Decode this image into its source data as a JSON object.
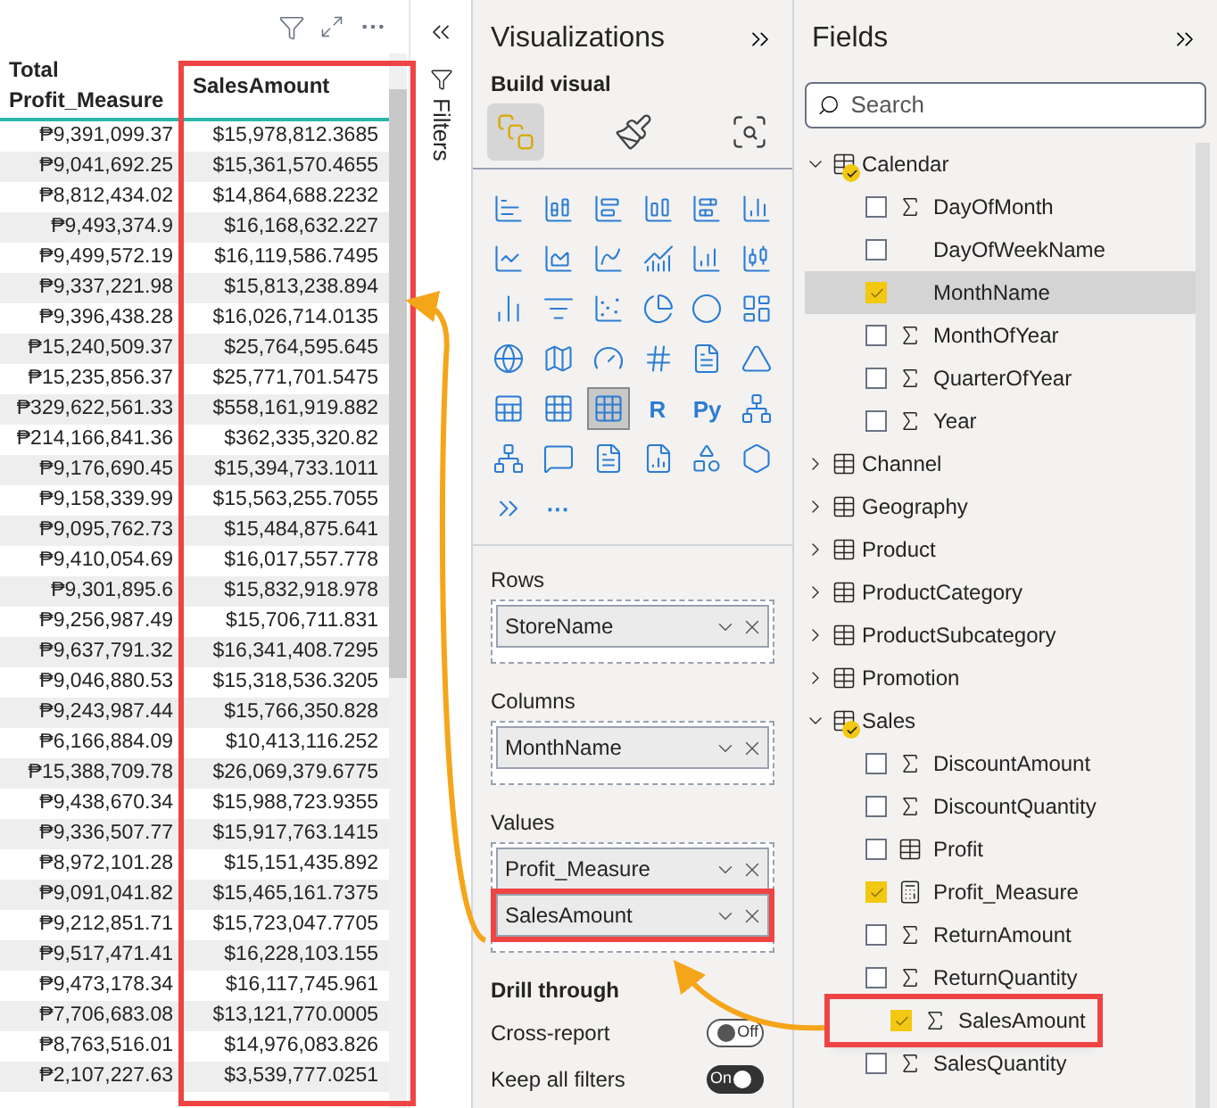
{
  "table": {
    "columns": [
      "Total Profit_Measure",
      "SalesAmount"
    ],
    "rows": [
      [
        "₱9,391,099.37",
        "$15,978,812.3685"
      ],
      [
        "₱9,041,692.25",
        "$15,361,570.4655"
      ],
      [
        "₱8,812,434.02",
        "$14,864,688.2232"
      ],
      [
        "₱9,493,374.9",
        "$16,168,632.227"
      ],
      [
        "₱9,499,572.19",
        "$16,119,586.7495"
      ],
      [
        "₱9,337,221.98",
        "$15,813,238.894"
      ],
      [
        "₱9,396,438.28",
        "$16,026,714.0135"
      ],
      [
        "₱15,240,509.37",
        "$25,764,595.645"
      ],
      [
        "₱15,235,856.37",
        "$25,771,701.5475"
      ],
      [
        "₱329,622,561.33",
        "$558,161,919.882"
      ],
      [
        "₱214,166,841.36",
        "$362,335,320.82"
      ],
      [
        "₱9,176,690.45",
        "$15,394,733.1011"
      ],
      [
        "₱9,158,339.99",
        "$15,563,255.7055"
      ],
      [
        "₱9,095,762.73",
        "$15,484,875.641"
      ],
      [
        "₱9,410,054.69",
        "$16,017,557.778"
      ],
      [
        "₱9,301,895.6",
        "$15,832,918.978"
      ],
      [
        "₱9,256,987.49",
        "$15,706,711.831"
      ],
      [
        "₱9,637,791.32",
        "$16,341,408.7295"
      ],
      [
        "₱9,046,880.53",
        "$15,318,536.3205"
      ],
      [
        "₱9,243,987.44",
        "$15,766,350.828"
      ],
      [
        "₱6,166,884.09",
        "$10,413,116.252"
      ],
      [
        "₱15,388,709.78",
        "$26,069,379.6775"
      ],
      [
        "₱9,438,670.34",
        "$15,988,723.9355"
      ],
      [
        "₱9,336,507.77",
        "$15,917,763.1415"
      ],
      [
        "₱8,972,101.28",
        "$15,151,435.892"
      ],
      [
        "₱9,091,041.82",
        "$15,465,161.7375"
      ],
      [
        "₱9,212,851.71",
        "$15,723,047.7705"
      ],
      [
        "₱9,517,471.41",
        "$16,228,103.155"
      ],
      [
        "₱9,473,178.34",
        "$16,117,745.961"
      ],
      [
        "₱7,706,683.08",
        "$13,121,770.0005"
      ],
      [
        "₱8,763,516.01",
        "$14,976,083.826"
      ],
      [
        "₱2,107,227.63",
        "$3,539,777.0251"
      ]
    ]
  },
  "filters_pane": {
    "label": "Filters"
  },
  "visualizations": {
    "title": "Visualizations",
    "build_label": "Build visual",
    "build_tabs": [
      {
        "selected": true
      },
      {
        "selected": false
      },
      {
        "selected": false
      }
    ],
    "visual_icons": [
      {
        "selected": false
      },
      {
        "selected": false
      },
      {
        "selected": false
      },
      {
        "selected": false
      },
      {
        "selected": false
      },
      {
        "selected": false
      },
      {
        "selected": false
      },
      {
        "selected": false
      },
      {
        "selected": false
      },
      {
        "selected": false
      },
      {
        "selected": false
      },
      {
        "selected": false
      },
      {
        "selected": false
      },
      {
        "selected": false
      },
      {
        "selected": false
      },
      {
        "selected": false
      },
      {
        "selected": false
      },
      {
        "selected": false
      },
      {
        "selected": false
      },
      {
        "selected": false
      },
      {
        "selected": false
      },
      {
        "selected": false
      },
      {
        "selected": false
      },
      {
        "selected": false
      },
      {
        "selected": false
      },
      {
        "selected": false
      },
      {
        "selected": true
      },
      {
        "selected": false,
        "label": "R"
      },
      {
        "selected": false,
        "label": "Py"
      },
      {
        "selected": false
      },
      {
        "selected": false
      },
      {
        "selected": false
      },
      {
        "selected": false
      },
      {
        "selected": false
      },
      {
        "selected": false
      },
      {
        "selected": false
      },
      {
        "selected": false
      },
      {
        "selected": false,
        "label": "···"
      }
    ],
    "wells": [
      {
        "label": "Rows",
        "fields": [
          {
            "name": "StoreName",
            "highlighted": false
          }
        ]
      },
      {
        "label": "Columns",
        "fields": [
          {
            "name": "MonthName",
            "highlighted": false
          }
        ]
      },
      {
        "label": "Values",
        "fields": [
          {
            "name": "Profit_Measure",
            "highlighted": false
          },
          {
            "name": "SalesAmount",
            "highlighted": true
          }
        ]
      }
    ],
    "drill_through": {
      "title": "Drill through",
      "toggles": [
        {
          "label": "Cross-report",
          "on": false,
          "state_text": "Off"
        },
        {
          "label": "Keep all filters",
          "on": true,
          "state_text": "On"
        }
      ]
    }
  },
  "fields": {
    "title": "Fields",
    "search": {
      "placeholder": "Search"
    },
    "tables": [
      {
        "name": "Calendar",
        "expanded": true,
        "in_use": true,
        "children": [
          {
            "name": "DayOfMonth",
            "kind": "sigma",
            "checked": false,
            "selected": false,
            "highlighted": false
          },
          {
            "name": "DayOfWeekName",
            "kind": "text",
            "checked": false,
            "selected": false,
            "highlighted": false
          },
          {
            "name": "MonthName",
            "kind": "text",
            "checked": true,
            "selected": true,
            "highlighted": false
          },
          {
            "name": "MonthOfYear",
            "kind": "sigma",
            "checked": false,
            "selected": false,
            "highlighted": false
          },
          {
            "name": "QuarterOfYear",
            "kind": "sigma",
            "checked": false,
            "selected": false,
            "highlighted": false
          },
          {
            "name": "Year",
            "kind": "sigma",
            "checked": false,
            "selected": false,
            "highlighted": false
          }
        ]
      },
      {
        "name": "Channel",
        "expanded": false,
        "in_use": false
      },
      {
        "name": "Geography",
        "expanded": false,
        "in_use": false
      },
      {
        "name": "Product",
        "expanded": false,
        "in_use": false
      },
      {
        "name": "ProductCategory",
        "expanded": false,
        "in_use": false
      },
      {
        "name": "ProductSubcategory",
        "expanded": false,
        "in_use": false
      },
      {
        "name": "Promotion",
        "expanded": false,
        "in_use": false
      },
      {
        "name": "Sales",
        "expanded": true,
        "in_use": true,
        "children": [
          {
            "name": "DiscountAmount",
            "kind": "sigma",
            "checked": false,
            "selected": false,
            "highlighted": false
          },
          {
            "name": "DiscountQuantity",
            "kind": "sigma",
            "checked": false,
            "selected": false,
            "highlighted": false
          },
          {
            "name": "Profit",
            "kind": "table_measure",
            "checked": false,
            "selected": false,
            "highlighted": false
          },
          {
            "name": "Profit_Measure",
            "kind": "calculator",
            "checked": true,
            "selected": false,
            "highlighted": false
          },
          {
            "name": "ReturnAmount",
            "kind": "sigma",
            "checked": false,
            "selected": false,
            "highlighted": false
          },
          {
            "name": "ReturnQuantity",
            "kind": "sigma",
            "checked": false,
            "selected": false,
            "highlighted": false
          },
          {
            "name": "SalesAmount",
            "kind": "sigma",
            "checked": true,
            "selected": false,
            "highlighted": true
          },
          {
            "name": "SalesQuantity",
            "kind": "sigma",
            "checked": false,
            "selected": false,
            "highlighted": false
          }
        ]
      }
    ]
  }
}
